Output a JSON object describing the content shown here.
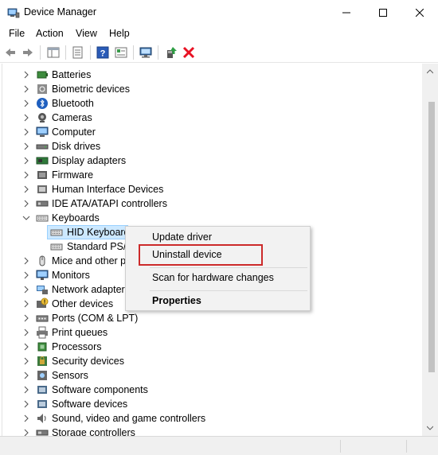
{
  "window": {
    "title": "Device Manager",
    "app_icon": "device-manager-icon",
    "controls": [
      "minimize-icon",
      "maximize-icon",
      "close-icon"
    ]
  },
  "menu": {
    "items": [
      "File",
      "Action",
      "View",
      "Help"
    ]
  },
  "toolbar": {
    "icons": [
      "back-arrow-icon",
      "forward-arrow-icon",
      "show-hide-console-tree-icon",
      "properties-icon",
      "help-icon",
      "view-icon",
      "scan-hardware-icon",
      "update-driver-icon",
      "uninstall-device-icon"
    ]
  },
  "tree": {
    "items": [
      {
        "label": "Batteries",
        "expanded": false,
        "icon": "battery-icon"
      },
      {
        "label": "Biometric devices",
        "expanded": false,
        "icon": "fingerprint-icon"
      },
      {
        "label": "Bluetooth",
        "expanded": false,
        "icon": "bluetooth-icon"
      },
      {
        "label": "Cameras",
        "expanded": false,
        "icon": "camera-icon"
      },
      {
        "label": "Computer",
        "expanded": false,
        "icon": "computer-icon"
      },
      {
        "label": "Disk drives",
        "expanded": false,
        "icon": "disk-drive-icon"
      },
      {
        "label": "Display adapters",
        "expanded": false,
        "icon": "display-adapter-icon"
      },
      {
        "label": "Firmware",
        "expanded": false,
        "icon": "firmware-icon"
      },
      {
        "label": "Human Interface Devices",
        "expanded": false,
        "icon": "hid-icon"
      },
      {
        "label": "IDE ATA/ATAPI controllers",
        "expanded": false,
        "icon": "ide-controller-icon"
      },
      {
        "label": "Keyboards",
        "expanded": true,
        "icon": "keyboard-icon"
      },
      {
        "label": "HID Keyboard",
        "child": true,
        "selected": true,
        "icon": "keyboard-icon"
      },
      {
        "label": "Standard PS/2",
        "child": true,
        "icon": "keyboard-icon"
      },
      {
        "label": "Mice and other p",
        "expanded": false,
        "icon": "mouse-icon"
      },
      {
        "label": "Monitors",
        "expanded": false,
        "icon": "monitor-icon"
      },
      {
        "label": "Network adapters",
        "expanded": false,
        "icon": "network-adapter-icon"
      },
      {
        "label": "Other devices",
        "expanded": false,
        "icon": "other-devices-icon"
      },
      {
        "label": "Ports (COM & LPT)",
        "expanded": false,
        "icon": "port-icon"
      },
      {
        "label": "Print queues",
        "expanded": false,
        "icon": "printer-icon"
      },
      {
        "label": "Processors",
        "expanded": false,
        "icon": "processor-icon"
      },
      {
        "label": "Security devices",
        "expanded": false,
        "icon": "security-device-icon"
      },
      {
        "label": "Sensors",
        "expanded": false,
        "icon": "sensor-icon"
      },
      {
        "label": "Software components",
        "expanded": false,
        "icon": "software-component-icon"
      },
      {
        "label": "Software devices",
        "expanded": false,
        "icon": "software-device-icon"
      },
      {
        "label": "Sound, video and game controllers",
        "expanded": false,
        "icon": "sound-icon"
      },
      {
        "label": "Storage controllers",
        "expanded": false,
        "icon": "storage-controller-icon"
      }
    ]
  },
  "context_menu": {
    "items": [
      {
        "label": "Update driver",
        "bold": false
      },
      {
        "label": "Uninstall device",
        "bold": false,
        "highlighted": true
      },
      {
        "label": "Scan for hardware changes",
        "bold": false
      },
      {
        "label": "Properties",
        "bold": true
      }
    ],
    "highlight_color": "#cc2a2a"
  },
  "colors": {
    "selection_bg": "#cce8ff",
    "selection_border": "#99d1ff",
    "uninstall_red": "#e81123",
    "update_green": "#2e9e44"
  }
}
